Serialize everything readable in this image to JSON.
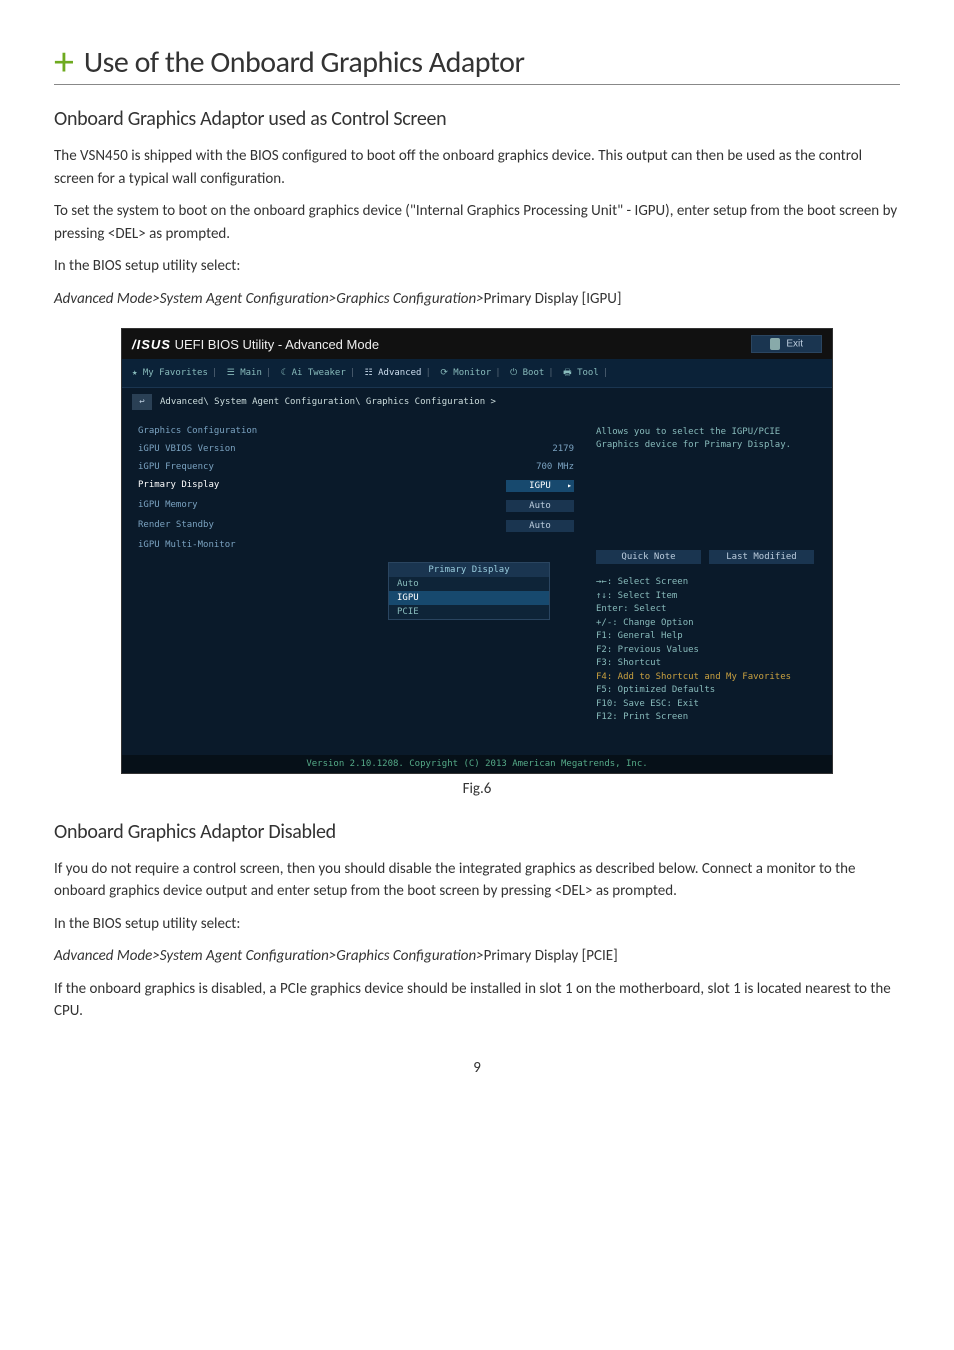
{
  "page": {
    "h1": "Use of the Onboard Graphics Adaptor",
    "h2a": "Onboard Graphics Adaptor used as Control Screen",
    "p1": "The VSN450 is shipped with the BIOS configured to boot off the onboard graphics device.  This output can then be used as the control screen for a typical wall configuration.",
    "p2": "To set the system to boot on the onboard graphics device (\"Internal Graphics Processing Unit\" - IGPU), enter setup from the boot screen by pressing <DEL> as prompted.",
    "p3": "In the BIOS setup utility select:",
    "path_a_italic": "Advanced Mode>System Agent Configuration>Graphics Configuration>",
    "path_a_tail": "Primary Display [IGPU]",
    "fig_label": "Fig.6",
    "h2b": "Onboard Graphics Adaptor Disabled",
    "p4": "If you do not require a control screen, then you should disable the integrated graphics as described below. Connect a monitor to the onboard graphics device output and enter setup from the boot screen by pressing <DEL> as prompted.",
    "p5": "In the BIOS setup utility select:",
    "path_b_italic": "Advanced Mode>System Agent Configuration>Graphics Configuration>",
    "path_b_tail": "Primary Display [PCIE]",
    "p6": "If the onboard graphics is disabled, a PCIe graphics device should be installed in slot 1 on the motherboard, slot 1 is located nearest to the CPU.",
    "page_number": "9"
  },
  "bios": {
    "title_mode": " UEFI BIOS Utility - Advanced Mode",
    "exit": "Exit",
    "tabs": {
      "fav": "★ My Favorites",
      "main": "Main",
      "ai": "Ai Tweaker",
      "adv": "Advanced",
      "mon": "Monitor",
      "boot": "Boot",
      "tool": "Tool"
    },
    "breadcrumb": "Advanced\\ System Agent Configuration\\ Graphics Configuration >",
    "rows": {
      "gfx_cfg": "Graphics Configuration",
      "vbios_l": "iGPU VBIOS Version",
      "vbios_v": "2179",
      "freq_l": "iGPU Frequency",
      "freq_v": "700 MHz",
      "prim_l": "Primary Display",
      "prim_v": "IGPU",
      "mem_l": "iGPU Memory",
      "mem_v": "Auto",
      "rs_l": "Render Standby",
      "rs_v": "Auto",
      "mm_l": "iGPU Multi-Monitor"
    },
    "dropdown": {
      "title": "Primary Display",
      "opt1": "Auto",
      "opt2": "IGPU",
      "opt3": "PCIE"
    },
    "help": "Allows you to select the IGPU/PCIE Graphics device for Primary Display.",
    "quicknote": "Quick Note",
    "lastmod": "Last Modified",
    "keys": {
      "k1": "→←: Select Screen",
      "k2": "↑↓: Select Item",
      "k3": "Enter: Select",
      "k4": "+/-: Change Option",
      "k5": "F1: General Help",
      "k6": "F2: Previous Values",
      "k7": "F3: Shortcut",
      "k8": "F4: Add to Shortcut and My Favorites",
      "k9": "F5: Optimized Defaults",
      "k10": "F10: Save  ESC: Exit",
      "k11": "F12: Print Screen"
    },
    "footer": "Version 2.10.1208. Copyright (C) 2013 American Megatrends, Inc."
  }
}
